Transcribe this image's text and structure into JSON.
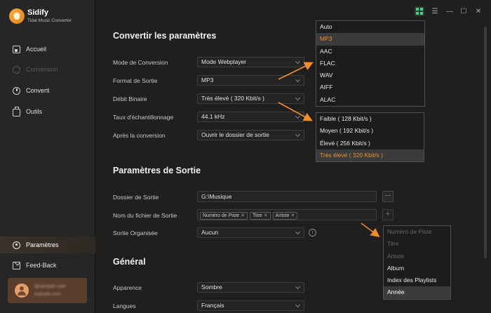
{
  "brand": {
    "name": "Sidify",
    "subtitle": "Tidal Music Converter"
  },
  "sidebar": {
    "items": [
      {
        "label": "Accueil",
        "icon": "home-icon",
        "state": "normal"
      },
      {
        "label": "Conversion",
        "icon": "conversion-icon",
        "state": "disabled"
      },
      {
        "label": "Converti",
        "icon": "clock-icon",
        "state": "normal"
      },
      {
        "label": "Outils",
        "icon": "toolbox-icon",
        "state": "normal"
      }
    ],
    "bottom_items": [
      {
        "label": "Paramètres",
        "icon": "gear-icon",
        "state": "active"
      },
      {
        "label": "Feed-Back",
        "icon": "mail-icon",
        "state": "normal"
      }
    ],
    "user": {
      "name": "@sample.user",
      "email": "outlook.com"
    }
  },
  "titlebar": {
    "icons": [
      "grid-icon",
      "menu-icon",
      "minimize-icon",
      "maximize-icon",
      "close-icon"
    ]
  },
  "sections": {
    "convert_title": "Convertir les paramètres",
    "output_title": "Paramètres de Sortie",
    "general_title": "Général"
  },
  "convert": {
    "mode_label": "Mode de Conversion",
    "mode_value": "Mode Webplayer",
    "format_label": "Format de Sortie",
    "format_value": "MP3",
    "bitrate_label": "Débit Binaire",
    "bitrate_value": "Très élevé ( 320 Kbit/s )",
    "samplerate_label": "Taux d'échantillonnage",
    "samplerate_value": "44.1 kHz",
    "after_label": "Après la conversion",
    "after_value": "Ouvrir le dossier de sortie"
  },
  "output": {
    "folder_label": "Dossier de Sortie",
    "folder_value": "G:\\Musique",
    "folder_button": "···",
    "filename_label": "Nom du fichier de Sortie",
    "filename_tags": [
      "Numéro de Piste",
      "Titre",
      "Artiste"
    ],
    "add_button": "+",
    "organized_label": "Sortie Organisée",
    "organized_value": "Aucun",
    "info_glyph": "i"
  },
  "general": {
    "appearance_label": "Apparence",
    "appearance_value": "Sombre",
    "language_label": "Langues",
    "language_value": "Français"
  },
  "format_dropdown": {
    "options": [
      "Auto",
      "MP3",
      "AAC",
      "FLAC",
      "WAV",
      "AIFF",
      "ALAC"
    ],
    "selected": "MP3"
  },
  "bitrate_dropdown": {
    "options": [
      "Faible ( 128 Kbit/s )",
      "Moyen ( 192 Kbit/s )",
      "Élevé ( 256 Kbit/s )",
      "Très élevé ( 320 Kbit/s )"
    ],
    "selected": "Très élevé ( 320 Kbit/s )"
  },
  "organized_dropdown": {
    "options": [
      "Numéro de Piste",
      "Titre",
      "Artiste",
      "Album",
      "Index des Playlists",
      "Année"
    ],
    "disabled": [
      "Numéro de Piste",
      "Titre",
      "Artiste"
    ],
    "highlighted": "Année"
  },
  "colors": {
    "accent": "#f2922a",
    "arrow": "#f28c28",
    "background": "#1f1f1f",
    "sidebar": "#262626"
  }
}
